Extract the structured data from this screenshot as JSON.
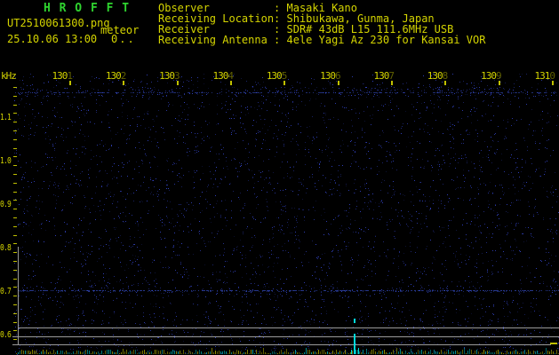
{
  "colors": {
    "background": "#000000",
    "title_green": "#2fd32f",
    "text_yellow": "#d4d400",
    "tick_yellow": "#c0c000",
    "grid_grey": "#9a9a9a",
    "noise_blue": "#4466ee",
    "echo_cyan": "#00d8d8",
    "level_yellow": "#909000",
    "level_cyan": "#009c9c"
  },
  "title": "H R O F F T",
  "file_label": "UT2510061300.png",
  "overlay_label": "meteor",
  "datetime_label": "25.10.06 13:00",
  "counter_label": "0..",
  "receiver_info": {
    "rows": [
      {
        "label": "Observer",
        "value": "Masaki Kano"
      },
      {
        "label": "Receiving Location",
        "value": "Shibukawa, Gunma, Japan"
      },
      {
        "label": "Receiver",
        "value": "SDR# 43dB L15 111.6MHz USB"
      },
      {
        "label": "Receiving Antenna",
        "value": "4ele Yagi Az 230 for Kansai VOR"
      }
    ]
  },
  "chart_data": {
    "type": "heatmap",
    "title": "",
    "xlabel": "",
    "ylabel": "kHz",
    "x_ticks": [
      "1301",
      "1302",
      "1303",
      "1304",
      "1305",
      "1306",
      "1307",
      "1308",
      "1309",
      "1310"
    ],
    "y_ticks": [
      "1.1",
      "1.0",
      "0.9",
      "0.8",
      "0.7",
      "0.6"
    ],
    "x_range_time": [
      "13:00",
      "13:10"
    ],
    "y_range_khz": [
      0.56,
      1.17
    ],
    "grid": false,
    "legend": "none",
    "background": "black with sparse blue receiver noise speckle",
    "features": [
      {
        "kind": "faint-noise-line",
        "freq_khz": 1.15
      },
      {
        "kind": "faint-noise-line",
        "freq_khz": 0.7
      },
      {
        "kind": "meteor-echo-mark",
        "time": "13:06.3",
        "freq_khz": 0.64,
        "color": "cyan"
      },
      {
        "kind": "level-divider-lines",
        "count": 3,
        "position": "bottom"
      },
      {
        "kind": "noise-level-trace",
        "position": "bottom edge",
        "colors": [
          "yellow",
          "cyan"
        ],
        "spike_time": "13:06.3"
      }
    ]
  }
}
